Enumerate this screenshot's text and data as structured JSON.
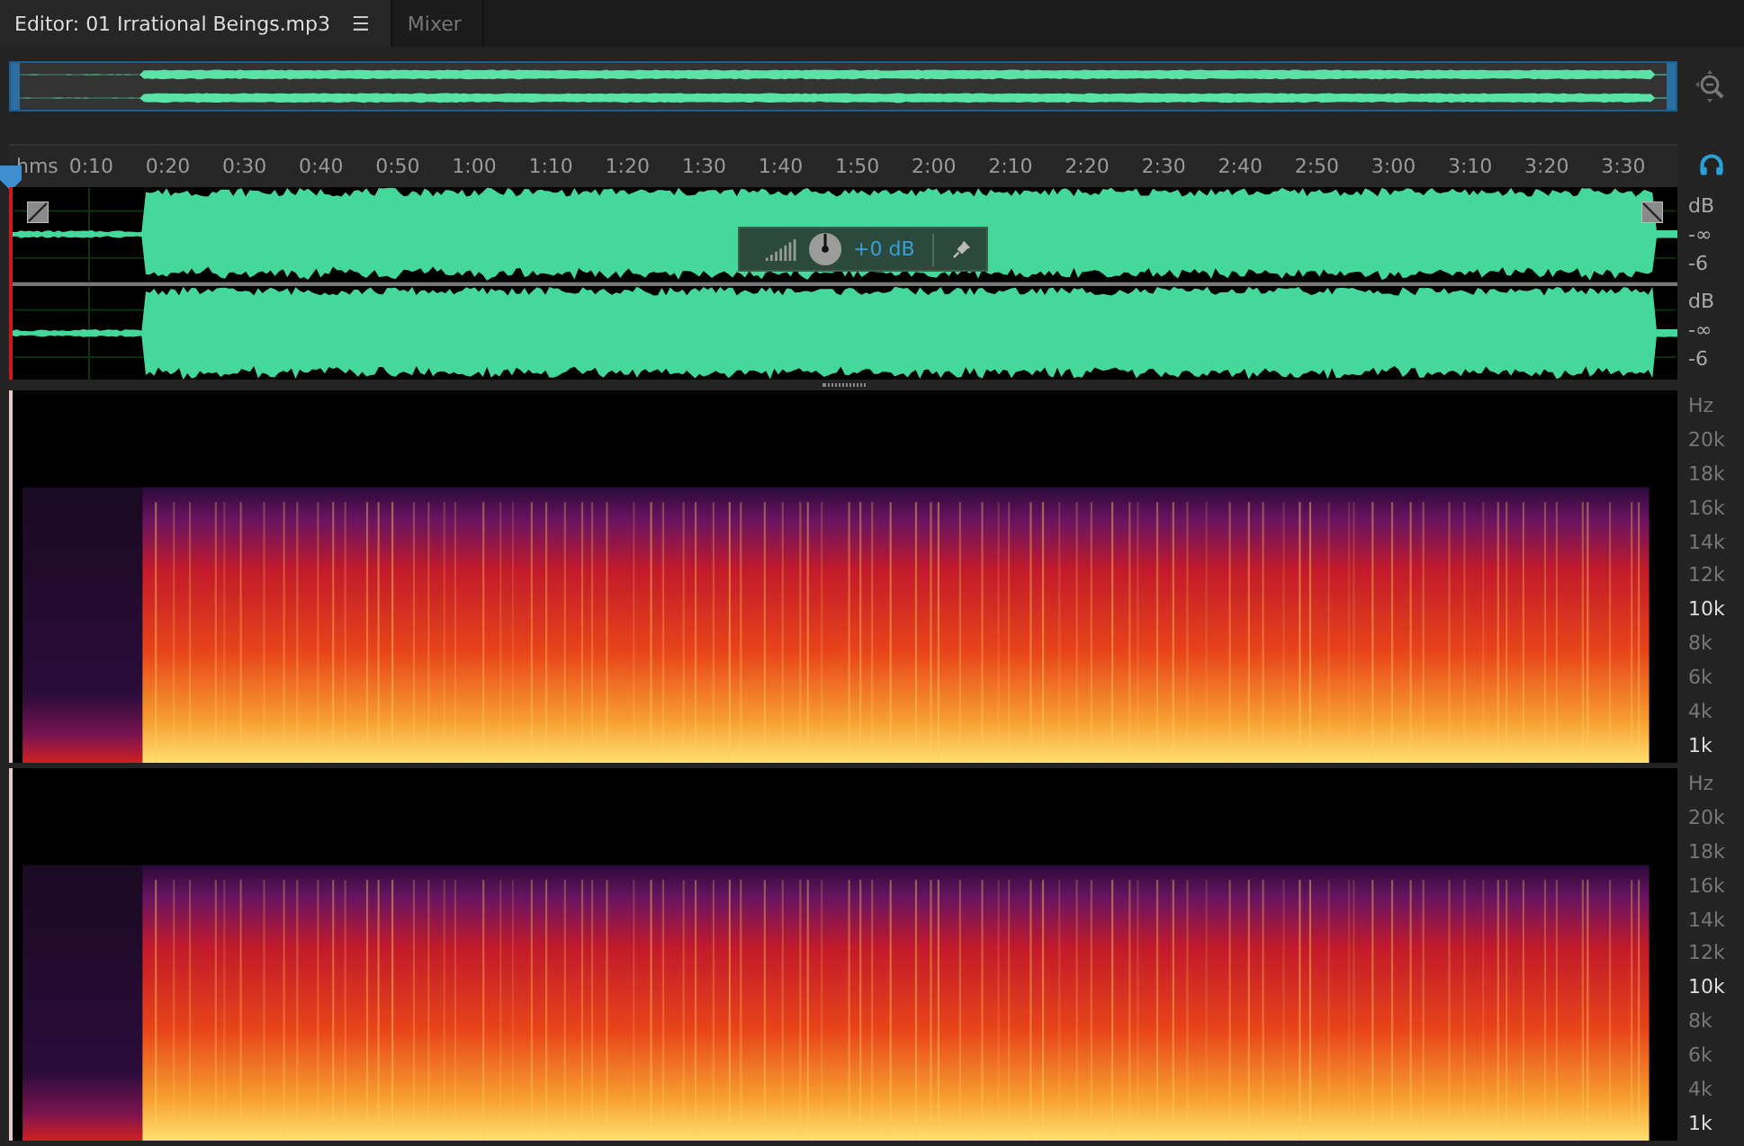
{
  "tabs": [
    {
      "label": "Editor: 01 Irrational Beings.mp3",
      "selected": true,
      "menu": "☰"
    },
    {
      "label": "Mixer",
      "selected": false
    }
  ],
  "ruler": {
    "unit": "hms",
    "ticks": [
      "0:10",
      "0:20",
      "0:30",
      "0:40",
      "0:50",
      "1:00",
      "1:10",
      "1:20",
      "1:30",
      "1:40",
      "1:50",
      "2:00",
      "2:10",
      "2:20",
      "2:30",
      "2:40",
      "2:50",
      "3:00",
      "3:10",
      "3:20",
      "3:30"
    ]
  },
  "waveform": {
    "channels": [
      {
        "db_labels": [
          "dB",
          "-∞",
          "-6"
        ]
      },
      {
        "db_labels": [
          "dB",
          "-∞",
          "-6"
        ]
      }
    ]
  },
  "hud": {
    "gain": "+0 dB"
  },
  "spectrogram": {
    "channels": [
      {
        "hz_labels": [
          {
            "text": "Hz",
            "highlighted": false
          },
          {
            "text": "20k",
            "highlighted": false
          },
          {
            "text": "18k",
            "highlighted": false
          },
          {
            "text": "16k",
            "highlighted": false
          },
          {
            "text": "14k",
            "highlighted": false
          },
          {
            "text": "12k",
            "highlighted": false
          },
          {
            "text": "10k",
            "highlighted": true
          },
          {
            "text": "8k",
            "highlighted": false
          },
          {
            "text": "6k",
            "highlighted": false
          },
          {
            "text": "4k",
            "highlighted": false
          },
          {
            "text": "1k",
            "highlighted": true
          }
        ]
      },
      {
        "hz_labels": [
          {
            "text": "Hz",
            "highlighted": false
          },
          {
            "text": "20k",
            "highlighted": false
          },
          {
            "text": "18k",
            "highlighted": false
          },
          {
            "text": "16k",
            "highlighted": false
          },
          {
            "text": "14k",
            "highlighted": false
          },
          {
            "text": "12k",
            "highlighted": false
          },
          {
            "text": "10k",
            "highlighted": true
          },
          {
            "text": "8k",
            "highlighted": false
          },
          {
            "text": "6k",
            "highlighted": false
          },
          {
            "text": "4k",
            "highlighted": false
          },
          {
            "text": "1k",
            "highlighted": true
          }
        ]
      }
    ]
  }
}
